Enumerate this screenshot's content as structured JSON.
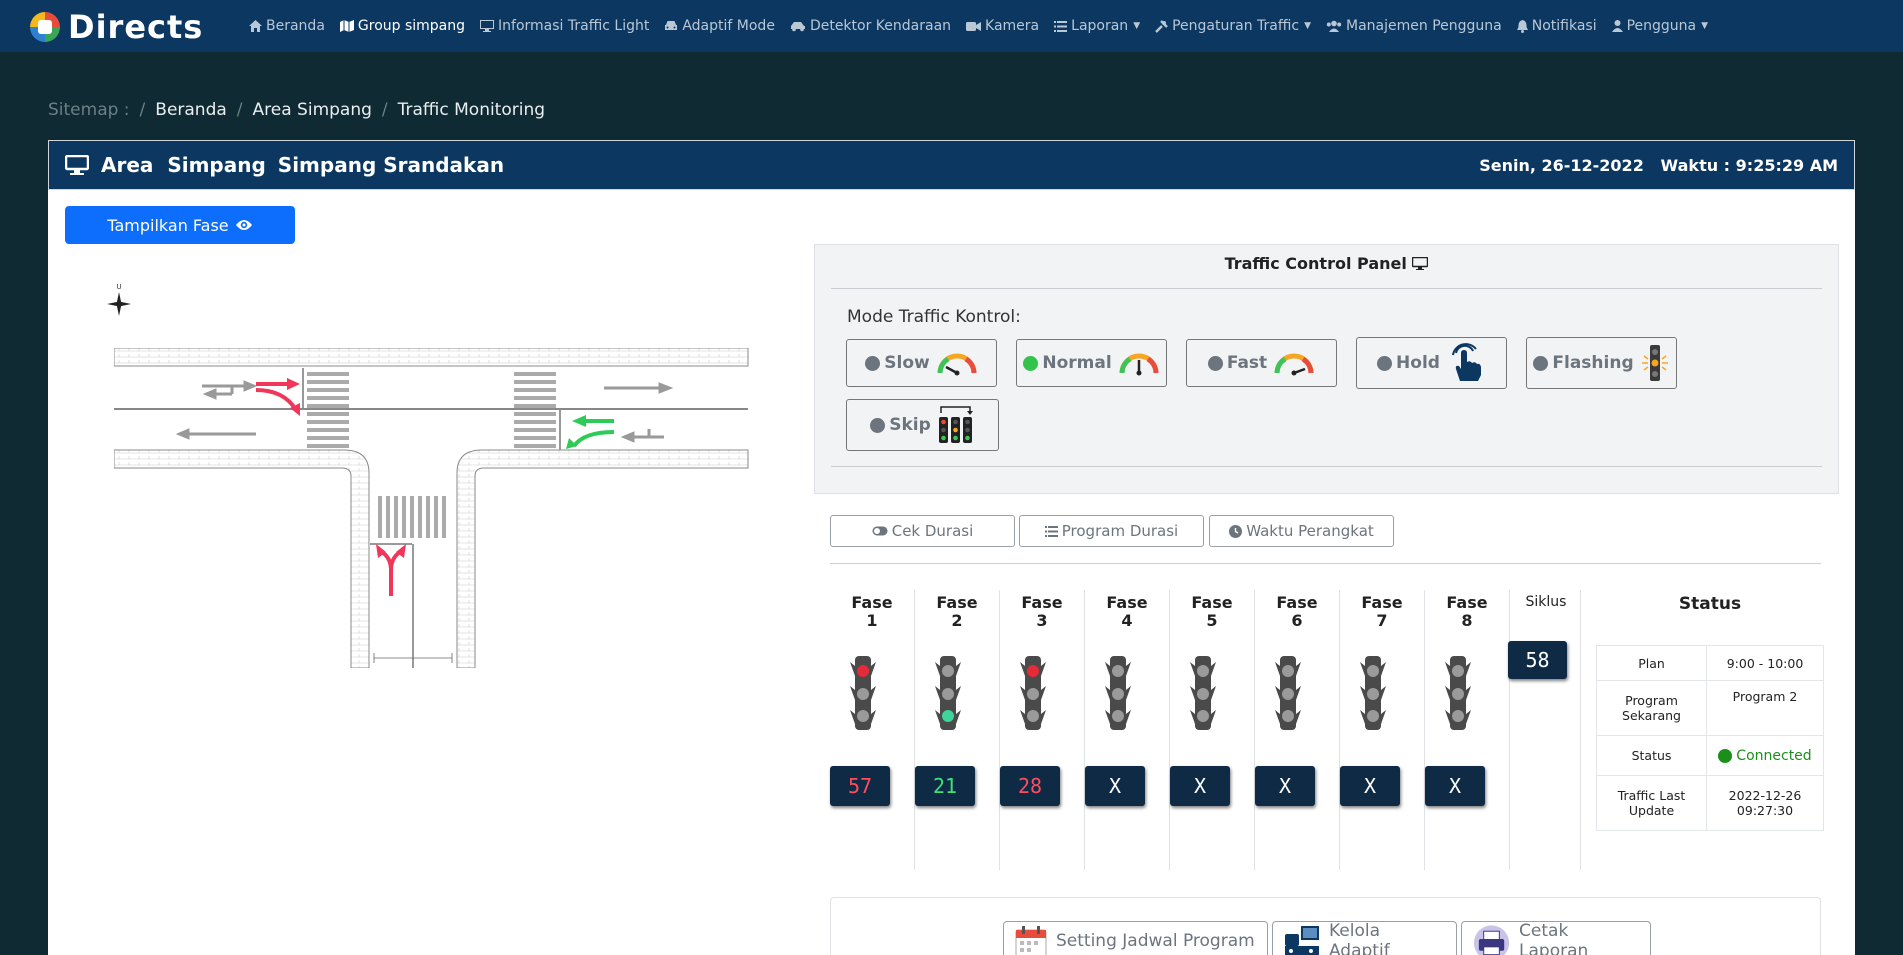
{
  "brand": {
    "name": "Directs"
  },
  "nav": {
    "items": [
      {
        "label": "Beranda",
        "icon": "home-icon"
      },
      {
        "label": "Group simpang",
        "icon": "map-icon"
      },
      {
        "label": "Informasi Traffic Light",
        "icon": "monitor-icon"
      },
      {
        "label": "Adaptif Mode",
        "icon": "car-icon"
      },
      {
        "label": "Detektor Kendaraan",
        "icon": "car-side-icon"
      },
      {
        "label": "Kamera",
        "icon": "video-icon"
      },
      {
        "label": "Laporan",
        "icon": "list-icon"
      },
      {
        "label": "Pengaturan Traffic",
        "icon": "tools-icon"
      },
      {
        "label": "Manajemen Pengguna",
        "icon": "users-icon"
      },
      {
        "label": "Notifikasi",
        "icon": "bell-icon"
      },
      {
        "label": "Pengguna",
        "icon": "user-icon"
      }
    ]
  },
  "breadcrumb": {
    "label": "Sitemap :",
    "items": [
      "Beranda",
      "Area Simpang",
      "Traffic Monitoring"
    ]
  },
  "header": {
    "title_prefix": "Area  Simpang",
    "title_name": "Simpang Srandakan",
    "date": "Senin, 26-12-2022",
    "time_label": "Waktu :",
    "time": "9:25:29 AM"
  },
  "show_phase_button": "Tampilkan Fase",
  "compass": {
    "north": "U"
  },
  "control_panel": {
    "title": "Traffic Control Panel",
    "mode_label": "Mode Traffic Kontrol:",
    "modes": [
      {
        "label": "Slow",
        "active": false,
        "icon": "speedometer-slow-icon"
      },
      {
        "label": "Normal",
        "active": true,
        "icon": "speedometer-normal-icon"
      },
      {
        "label": "Fast",
        "active": false,
        "icon": "speedometer-fast-icon"
      },
      {
        "label": "Hold",
        "active": false,
        "icon": "hand-pointer-icon"
      },
      {
        "label": "Flashing",
        "active": false,
        "icon": "flashing-light-icon"
      },
      {
        "label": "Skip",
        "active": false,
        "icon": "traffic-lights-skip-icon"
      }
    ]
  },
  "tabs": [
    {
      "label": "Cek Durasi",
      "icon": "toggle-icon"
    },
    {
      "label": "Program Durasi",
      "icon": "list-icon"
    },
    {
      "label": "Waktu Perangkat",
      "icon": "clock-icon"
    }
  ],
  "phases": [
    {
      "label": "Fase",
      "number": "1",
      "value": "57",
      "light": "red",
      "value_color": "#ff4d5e"
    },
    {
      "label": "Fase",
      "number": "2",
      "value": "21",
      "light": "green",
      "value_color": "#3fe07a"
    },
    {
      "label": "Fase",
      "number": "3",
      "value": "28",
      "light": "red",
      "value_color": "#ff4d5e"
    },
    {
      "label": "Fase",
      "number": "4",
      "value": "X",
      "light": "off",
      "value_color": "#ffffff"
    },
    {
      "label": "Fase",
      "number": "5",
      "value": "X",
      "light": "off",
      "value_color": "#ffffff"
    },
    {
      "label": "Fase",
      "number": "6",
      "value": "X",
      "light": "off",
      "value_color": "#ffffff"
    },
    {
      "label": "Fase",
      "number": "7",
      "value": "X",
      "light": "off",
      "value_color": "#ffffff"
    },
    {
      "label": "Fase",
      "number": "8",
      "value": "X",
      "light": "off",
      "value_color": "#ffffff"
    }
  ],
  "cycle": {
    "label": "Siklus",
    "value": "58"
  },
  "status": {
    "title": "Status",
    "rows": [
      {
        "key": "Plan",
        "value": "9:00 - 10:00"
      },
      {
        "key": "Program Sekarang",
        "value": "Program 2"
      },
      {
        "key": "Status",
        "value": "Connected"
      },
      {
        "key": "Traffic Last Update",
        "value": "2022-12-26 09:27:30"
      }
    ]
  },
  "actions": [
    {
      "label": "Setting Jadwal Program",
      "icon": "calendar-icon"
    },
    {
      "label": "Kelola Adaptif",
      "icon": "traffic-manage-icon"
    },
    {
      "label": "Cetak Laporan",
      "icon": "printer-icon"
    }
  ],
  "colors": {
    "navbar": "#0b3760",
    "background": "#102a33",
    "primary": "#0d6efd",
    "arrow_red": "#f0365a",
    "arrow_green": "#2ecc56",
    "counter_bg": "#0e2a45"
  }
}
